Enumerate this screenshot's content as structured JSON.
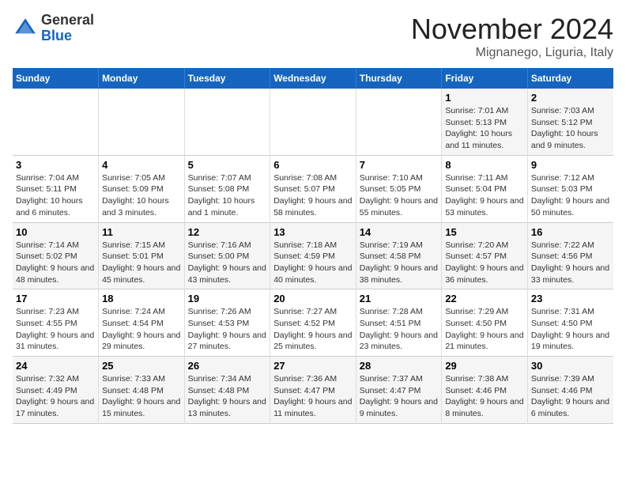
{
  "header": {
    "logo_general": "General",
    "logo_blue": "Blue",
    "month_title": "November 2024",
    "location": "Mignanego, Liguria, Italy"
  },
  "weekdays": [
    "Sunday",
    "Monday",
    "Tuesday",
    "Wednesday",
    "Thursday",
    "Friday",
    "Saturday"
  ],
  "weeks": [
    [
      {
        "day": "",
        "info": ""
      },
      {
        "day": "",
        "info": ""
      },
      {
        "day": "",
        "info": ""
      },
      {
        "day": "",
        "info": ""
      },
      {
        "day": "",
        "info": ""
      },
      {
        "day": "1",
        "info": "Sunrise: 7:01 AM\nSunset: 5:13 PM\nDaylight: 10 hours and 11 minutes."
      },
      {
        "day": "2",
        "info": "Sunrise: 7:03 AM\nSunset: 5:12 PM\nDaylight: 10 hours and 9 minutes."
      }
    ],
    [
      {
        "day": "3",
        "info": "Sunrise: 7:04 AM\nSunset: 5:11 PM\nDaylight: 10 hours and 6 minutes."
      },
      {
        "day": "4",
        "info": "Sunrise: 7:05 AM\nSunset: 5:09 PM\nDaylight: 10 hours and 3 minutes."
      },
      {
        "day": "5",
        "info": "Sunrise: 7:07 AM\nSunset: 5:08 PM\nDaylight: 10 hours and 1 minute."
      },
      {
        "day": "6",
        "info": "Sunrise: 7:08 AM\nSunset: 5:07 PM\nDaylight: 9 hours and 58 minutes."
      },
      {
        "day": "7",
        "info": "Sunrise: 7:10 AM\nSunset: 5:05 PM\nDaylight: 9 hours and 55 minutes."
      },
      {
        "day": "8",
        "info": "Sunrise: 7:11 AM\nSunset: 5:04 PM\nDaylight: 9 hours and 53 minutes."
      },
      {
        "day": "9",
        "info": "Sunrise: 7:12 AM\nSunset: 5:03 PM\nDaylight: 9 hours and 50 minutes."
      }
    ],
    [
      {
        "day": "10",
        "info": "Sunrise: 7:14 AM\nSunset: 5:02 PM\nDaylight: 9 hours and 48 minutes."
      },
      {
        "day": "11",
        "info": "Sunrise: 7:15 AM\nSunset: 5:01 PM\nDaylight: 9 hours and 45 minutes."
      },
      {
        "day": "12",
        "info": "Sunrise: 7:16 AM\nSunset: 5:00 PM\nDaylight: 9 hours and 43 minutes."
      },
      {
        "day": "13",
        "info": "Sunrise: 7:18 AM\nSunset: 4:59 PM\nDaylight: 9 hours and 40 minutes."
      },
      {
        "day": "14",
        "info": "Sunrise: 7:19 AM\nSunset: 4:58 PM\nDaylight: 9 hours and 38 minutes."
      },
      {
        "day": "15",
        "info": "Sunrise: 7:20 AM\nSunset: 4:57 PM\nDaylight: 9 hours and 36 minutes."
      },
      {
        "day": "16",
        "info": "Sunrise: 7:22 AM\nSunset: 4:56 PM\nDaylight: 9 hours and 33 minutes."
      }
    ],
    [
      {
        "day": "17",
        "info": "Sunrise: 7:23 AM\nSunset: 4:55 PM\nDaylight: 9 hours and 31 minutes."
      },
      {
        "day": "18",
        "info": "Sunrise: 7:24 AM\nSunset: 4:54 PM\nDaylight: 9 hours and 29 minutes."
      },
      {
        "day": "19",
        "info": "Sunrise: 7:26 AM\nSunset: 4:53 PM\nDaylight: 9 hours and 27 minutes."
      },
      {
        "day": "20",
        "info": "Sunrise: 7:27 AM\nSunset: 4:52 PM\nDaylight: 9 hours and 25 minutes."
      },
      {
        "day": "21",
        "info": "Sunrise: 7:28 AM\nSunset: 4:51 PM\nDaylight: 9 hours and 23 minutes."
      },
      {
        "day": "22",
        "info": "Sunrise: 7:29 AM\nSunset: 4:50 PM\nDaylight: 9 hours and 21 minutes."
      },
      {
        "day": "23",
        "info": "Sunrise: 7:31 AM\nSunset: 4:50 PM\nDaylight: 9 hours and 19 minutes."
      }
    ],
    [
      {
        "day": "24",
        "info": "Sunrise: 7:32 AM\nSunset: 4:49 PM\nDaylight: 9 hours and 17 minutes."
      },
      {
        "day": "25",
        "info": "Sunrise: 7:33 AM\nSunset: 4:48 PM\nDaylight: 9 hours and 15 minutes."
      },
      {
        "day": "26",
        "info": "Sunrise: 7:34 AM\nSunset: 4:48 PM\nDaylight: 9 hours and 13 minutes."
      },
      {
        "day": "27",
        "info": "Sunrise: 7:36 AM\nSunset: 4:47 PM\nDaylight: 9 hours and 11 minutes."
      },
      {
        "day": "28",
        "info": "Sunrise: 7:37 AM\nSunset: 4:47 PM\nDaylight: 9 hours and 9 minutes."
      },
      {
        "day": "29",
        "info": "Sunrise: 7:38 AM\nSunset: 4:46 PM\nDaylight: 9 hours and 8 minutes."
      },
      {
        "day": "30",
        "info": "Sunrise: 7:39 AM\nSunset: 4:46 PM\nDaylight: 9 hours and 6 minutes."
      }
    ]
  ]
}
